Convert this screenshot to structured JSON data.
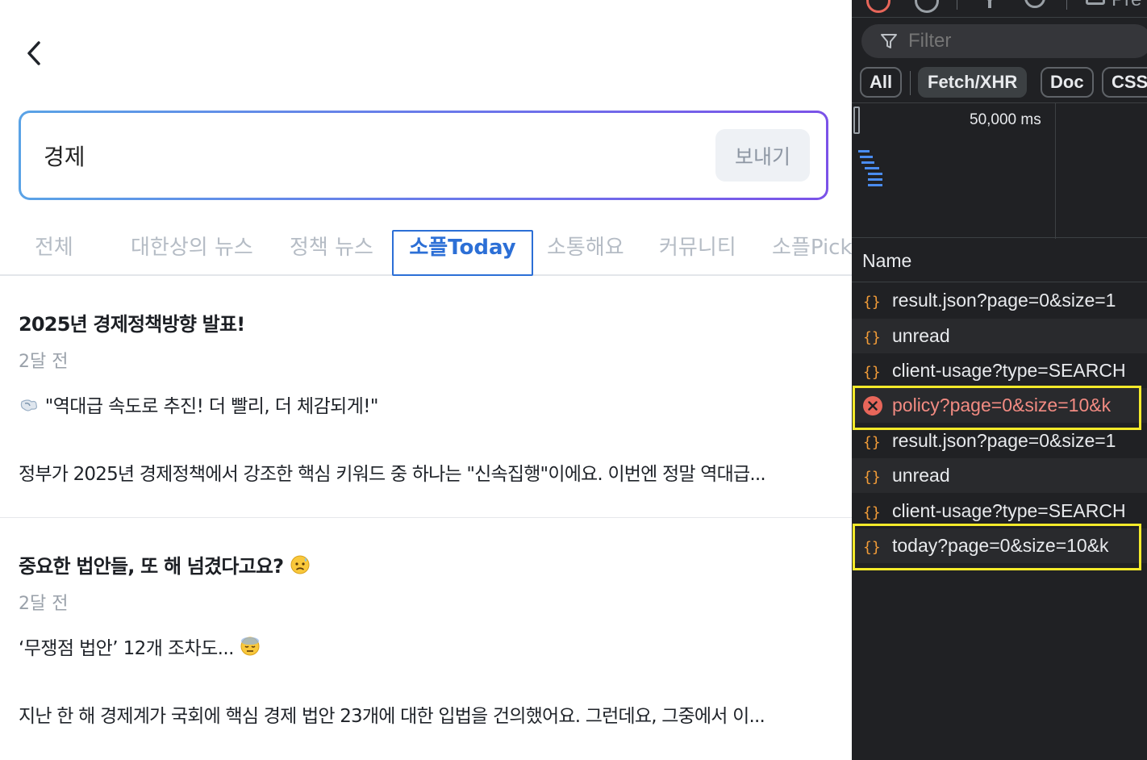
{
  "search": {
    "value": "경제",
    "send_label": "보내기"
  },
  "tabs": [
    "전체",
    "대한상의 뉴스",
    "정책 뉴스",
    "소플Today",
    "소통해요",
    "커뮤니티",
    "소플Pick"
  ],
  "posts": [
    {
      "title": "2025년 경제정책방향 발표!",
      "date": "2달 전",
      "line1": "\"역대급 속도로 추진! 더 빨리, 더 체감되게!\"",
      "line2": "정부가 2025년 경제정책에서 강조한 핵심 키워드 중 하나는 \"신속집행\"이에요. 이번엔 정말 역대급..."
    },
    {
      "title": "중요한 법안들, 또 해 넘겼다고요?",
      "date": "2달 전",
      "line1": "‘무쟁점 법안’ 12개 조차도...",
      "line2": "지난 한 해 경제계가 국회에 핵심 경제 법안 23개에 대한 입법을 건의했어요. 그런데요, 그중에서 이..."
    }
  ],
  "devtools": {
    "toolbar_partial_text": "Pre",
    "filter_placeholder": "Filter",
    "type_filters": [
      "All",
      "Fetch/XHR",
      "Doc",
      "CSS"
    ],
    "selected_type": "Fetch/XHR",
    "overview_time": "50,000 ms",
    "name_header": "Name",
    "requests": [
      {
        "name": "result.json?page=0&size=1",
        "status": "ok"
      },
      {
        "name": "unread",
        "status": "ok"
      },
      {
        "name": "client-usage?type=SEARCH",
        "status": "ok"
      },
      {
        "name": "policy?page=0&size=10&k",
        "status": "error"
      },
      {
        "name": "result.json?page=0&size=1",
        "status": "ok"
      },
      {
        "name": "unread",
        "status": "ok"
      },
      {
        "name": "client-usage?type=SEARCH",
        "status": "ok"
      },
      {
        "name": "today?page=0&size=10&k",
        "status": "ok"
      }
    ]
  },
  "colors": {
    "accent_blue": "#2c6fd6",
    "highlight_yellow": "#f4ea2a",
    "error_red": "#e8665a",
    "json_icon": "#f29c38"
  }
}
